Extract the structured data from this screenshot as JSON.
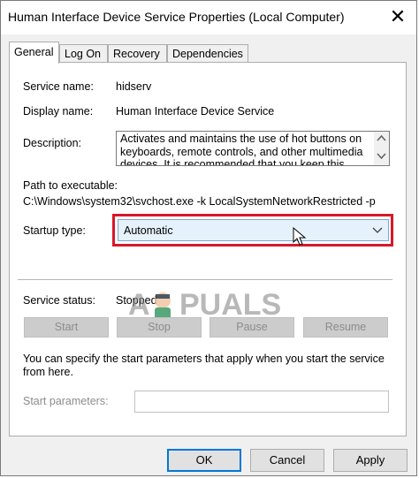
{
  "window": {
    "title": "Human Interface Device Service Properties (Local Computer)",
    "close_glyph": "✕"
  },
  "tabs": [
    {
      "label": "General",
      "active": true
    },
    {
      "label": "Log On",
      "active": false
    },
    {
      "label": "Recovery",
      "active": false
    },
    {
      "label": "Dependencies",
      "active": false
    }
  ],
  "general": {
    "service_name_label": "Service name:",
    "service_name_value": "hidserv",
    "display_name_label": "Display name:",
    "display_name_value": "Human Interface Device Service",
    "description_label": "Description:",
    "description_value": "Activates and maintains the use of hot buttons on keyboards, remote controls, and other multimedia devices. It is recommended that you keep this",
    "path_label": "Path to executable:",
    "path_value": "C:\\Windows\\system32\\svchost.exe -k LocalSystemNetworkRestricted -p",
    "startup_type_label": "Startup type:",
    "startup_type_value": "Automatic",
    "service_status_label": "Service status:",
    "service_status_value": "Stopped",
    "start_label": "Start",
    "stop_label": "Stop",
    "pause_label": "Pause",
    "resume_label": "Resume",
    "params_help": "You can specify the start parameters that apply when you start the service from here.",
    "start_params_label": "Start parameters:",
    "start_params_value": ""
  },
  "footer": {
    "ok_label": "OK",
    "cancel_label": "Cancel",
    "apply_label": "Apply"
  },
  "watermark": {
    "text": "A PUALS"
  },
  "colors": {
    "highlight": "#d8182a",
    "accent": "#0078d7",
    "combo_bg": "#e5f1fb"
  }
}
